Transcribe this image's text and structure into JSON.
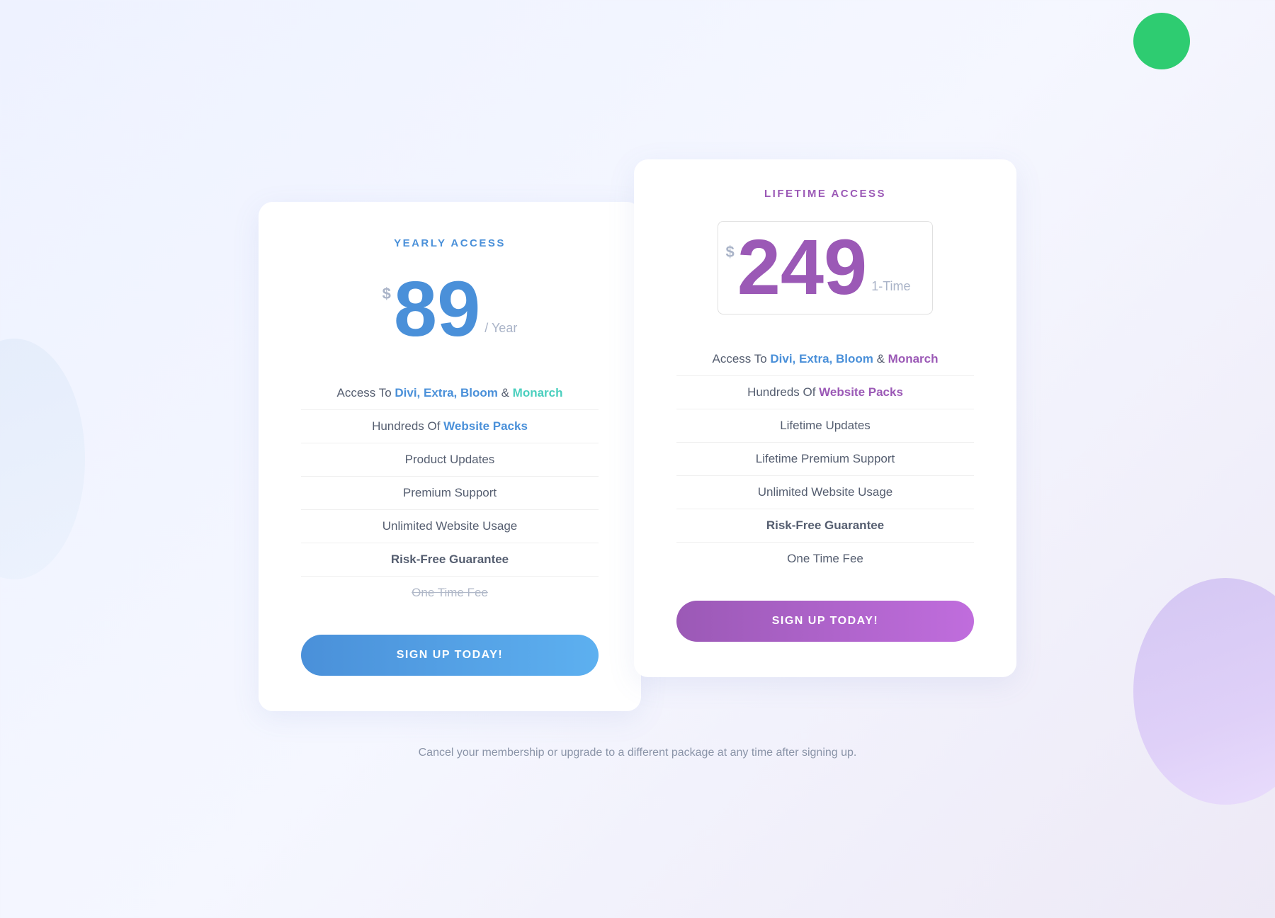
{
  "decorative": {
    "green_circle": "green-circle",
    "purple_circle": "purple-circle",
    "left_circle": "left-circle"
  },
  "yearly": {
    "label": "YEARLY ACCESS",
    "price_dollar": "$",
    "price_number": "89",
    "price_suffix": "/ Year",
    "features": [
      {
        "text_before": "Access To ",
        "highlight_blue": "Divi, Extra, Bloom",
        "text_middle": " & ",
        "highlight_teal": "Monarch",
        "type": "access"
      },
      {
        "text_before": "Hundreds Of ",
        "highlight_blue": "Website Packs",
        "type": "packs"
      },
      {
        "text": "Product Updates",
        "type": "normal"
      },
      {
        "text": "Premium Support",
        "type": "normal"
      },
      {
        "text": "Unlimited Website Usage",
        "type": "normal"
      },
      {
        "text": "Risk-Free Guarantee",
        "type": "green"
      },
      {
        "text": "One Time Fee",
        "type": "strikethrough"
      }
    ],
    "cta": "SIGN UP TODAY!"
  },
  "lifetime": {
    "label": "LIFETIME ACCESS",
    "price_dollar": "$",
    "price_number": "249",
    "price_suffix": "1-Time",
    "features": [
      {
        "text_before": "Access To ",
        "highlight_blue": "Divi, Extra, Bloom",
        "text_middle": " & ",
        "highlight_purple": "Monarch",
        "type": "access"
      },
      {
        "text_before": "Hundreds Of ",
        "highlight_purple": "Website Packs",
        "type": "packs"
      },
      {
        "text": "Lifetime Updates",
        "type": "normal"
      },
      {
        "text": "Lifetime Premium Support",
        "type": "normal"
      },
      {
        "text": "Unlimited Website Usage",
        "type": "normal"
      },
      {
        "text": "Risk-Free Guarantee",
        "type": "green"
      },
      {
        "text": "One Time Fee",
        "type": "normal"
      }
    ],
    "cta": "SIGN UP TODAY!"
  },
  "footer": {
    "note": "Cancel your membership or upgrade to a different package at any time after signing up."
  }
}
